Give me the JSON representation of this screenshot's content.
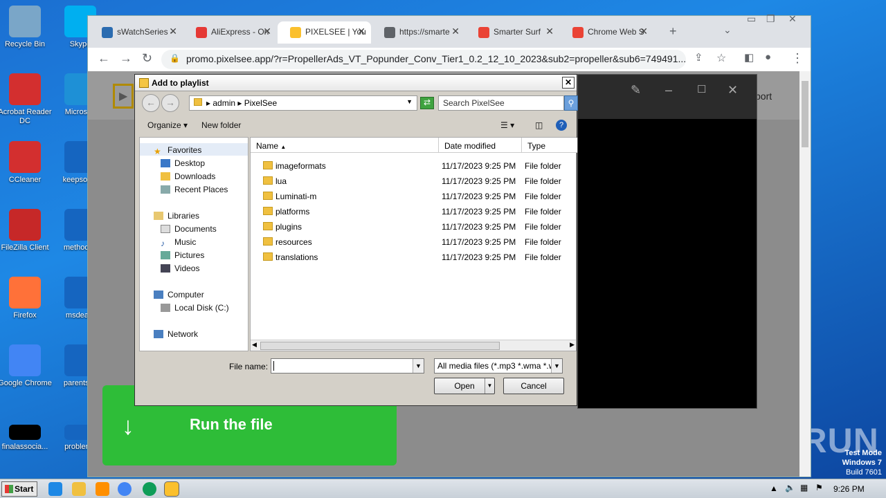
{
  "desktop": {
    "icons": [
      {
        "label": "Recycle Bin",
        "color": "#7aa6c8"
      },
      {
        "label": "Skype",
        "color": "#00aff0"
      },
      {
        "label": "Acrobat Reader DC",
        "color": "#d32f2f"
      },
      {
        "label": "Microsoft",
        "color": "#1e90d6"
      },
      {
        "label": "CCleaner",
        "color": "#d32f2f"
      },
      {
        "label": "keepsome",
        "color": "#1565c0"
      },
      {
        "label": "FileZilla Client",
        "color": "#c62828"
      },
      {
        "label": "methodsp",
        "color": "#1565c0"
      },
      {
        "label": "Firefox",
        "color": "#ff7139"
      },
      {
        "label": "msdeal.r",
        "color": "#1565c0"
      },
      {
        "label": "Google Chrome",
        "color": "#4285f4"
      },
      {
        "label": "parentsca",
        "color": "#1565c0"
      },
      {
        "label": "finalassocia...",
        "color": "#000000"
      },
      {
        "label": "problemb",
        "color": "#1565c0"
      }
    ]
  },
  "browser": {
    "tabs": [
      {
        "label": "sWatchSeries -",
        "icon": "#2b6cb0"
      },
      {
        "label": "AliExpress - On",
        "icon": "#e53935"
      },
      {
        "label": "PIXELSEE | You",
        "icon": "#fbc02d"
      },
      {
        "label": "https://smarte",
        "icon": "#5f6368"
      },
      {
        "label": "Smarter Surf",
        "icon": "#ea4335"
      },
      {
        "label": "Chrome Web S",
        "icon": "#ea4335"
      }
    ],
    "url": "promo.pixelsee.app/?r=PropellerAds_VT_Popunder_Conv_Tier1_0.2_12_10_2023&sub2=propeller&sub6=749491...",
    "page_fragment": "port"
  },
  "dialog": {
    "title": "Add to playlist",
    "path": [
      "admin",
      "PixelSee"
    ],
    "search_placeholder": "Search PixelSee",
    "organize": "Organize",
    "new_folder": "New folder",
    "nav": {
      "favorites": "Favorites",
      "desktop": "Desktop",
      "downloads": "Downloads",
      "recent": "Recent Places",
      "libraries": "Libraries",
      "documents": "Documents",
      "music": "Music",
      "pictures": "Pictures",
      "videos": "Videos",
      "computer": "Computer",
      "localdisk": "Local Disk (C:)",
      "network": "Network"
    },
    "columns": {
      "name": "Name",
      "date": "Date modified",
      "type": "Type"
    },
    "files": [
      {
        "name": "imageformats",
        "date": "11/17/2023 9:25 PM",
        "type": "File folder"
      },
      {
        "name": "lua",
        "date": "11/17/2023 9:25 PM",
        "type": "File folder"
      },
      {
        "name": "Luminati-m",
        "date": "11/17/2023 9:25 PM",
        "type": "File folder"
      },
      {
        "name": "platforms",
        "date": "11/17/2023 9:25 PM",
        "type": "File folder"
      },
      {
        "name": "plugins",
        "date": "11/17/2023 9:25 PM",
        "type": "File folder"
      },
      {
        "name": "resources",
        "date": "11/17/2023 9:25 PM",
        "type": "File folder"
      },
      {
        "name": "translations",
        "date": "11/17/2023 9:25 PM",
        "type": "File folder"
      }
    ],
    "filename_label": "File name:",
    "filename_value": "",
    "filter": "All media files (*.mp3 *.wma *.w",
    "open": "Open",
    "cancel": "Cancel"
  },
  "banner": {
    "text": "Run the file"
  },
  "watermark": {
    "brand": "ANY RUN",
    "line1": "Test Mode",
    "line2": "Windows 7",
    "line3": "Build 7601"
  },
  "taskbar": {
    "start": "Start",
    "clock": "9:26 PM"
  }
}
